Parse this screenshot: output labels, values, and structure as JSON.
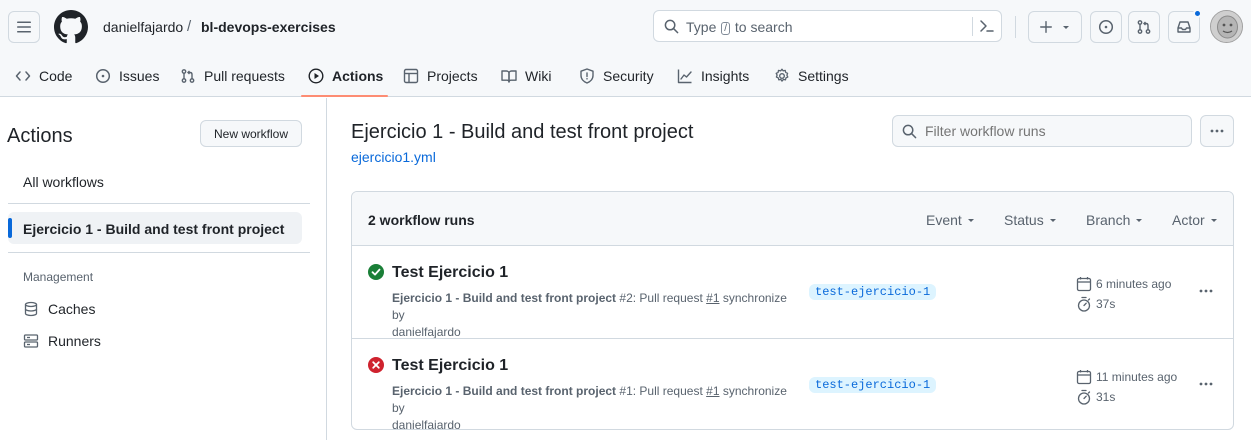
{
  "header": {
    "owner": "danielfajardo",
    "separator": "/",
    "repo": "bl-devops-exercises",
    "search": {
      "prefix": "Type",
      "key": "/",
      "suffix": "to search"
    }
  },
  "repo_nav": {
    "items": [
      {
        "label": "Code",
        "icon": "code-icon"
      },
      {
        "label": "Issues",
        "icon": "issue-opened-icon"
      },
      {
        "label": "Pull requests",
        "icon": "git-pull-request-icon"
      },
      {
        "label": "Actions",
        "icon": "play-icon"
      },
      {
        "label": "Projects",
        "icon": "table-icon"
      },
      {
        "label": "Wiki",
        "icon": "book-icon"
      },
      {
        "label": "Security",
        "icon": "shield-icon"
      },
      {
        "label": "Insights",
        "icon": "graph-icon"
      },
      {
        "label": "Settings",
        "icon": "gear-icon"
      }
    ],
    "active": "Actions"
  },
  "sidebar": {
    "title": "Actions",
    "new_workflow_label": "New workflow",
    "all_workflows_label": "All workflows",
    "active_workflow_label": "Ejercicio 1 - Build and test front project",
    "management_heading": "Management",
    "management_items": [
      {
        "label": "Caches",
        "icon": "database-icon"
      },
      {
        "label": "Runners",
        "icon": "server-icon"
      }
    ]
  },
  "main": {
    "title": "Ejercicio 1 - Build and test front project",
    "file_link": "ejercicio1.yml",
    "filter_placeholder": "Filter workflow runs",
    "runs_count_label": "2 workflow runs",
    "filters": [
      "Event",
      "Status",
      "Branch",
      "Actor"
    ],
    "runs": [
      {
        "status": "success",
        "title": "Test Ejercicio 1",
        "workflow_name": "Ejercicio 1 - Build and test front project",
        "run_number": "#2",
        "event_text": ": Pull request",
        "pr_number": "#1",
        "action_text": "synchronize by",
        "actor": "danielfajardo",
        "branch": "test-ejercicio-1",
        "time_ago": "6 minutes ago",
        "duration": "37s"
      },
      {
        "status": "failure",
        "title": "Test Ejercicio 1",
        "workflow_name": "Ejercicio 1 - Build and test front project",
        "run_number": "#1",
        "event_text": ": Pull request",
        "pr_number": "#1",
        "action_text": "synchronize by",
        "actor": "danielfajardo",
        "branch": "test-ejercicio-1",
        "time_ago": "11 minutes ago",
        "duration": "31s"
      }
    ]
  },
  "colors": {
    "accent": "#0969da",
    "success": "#1a7f37",
    "failure": "#cf222e",
    "nav_underline": "#fd8c73",
    "branch_bg": "#ddf4ff"
  }
}
